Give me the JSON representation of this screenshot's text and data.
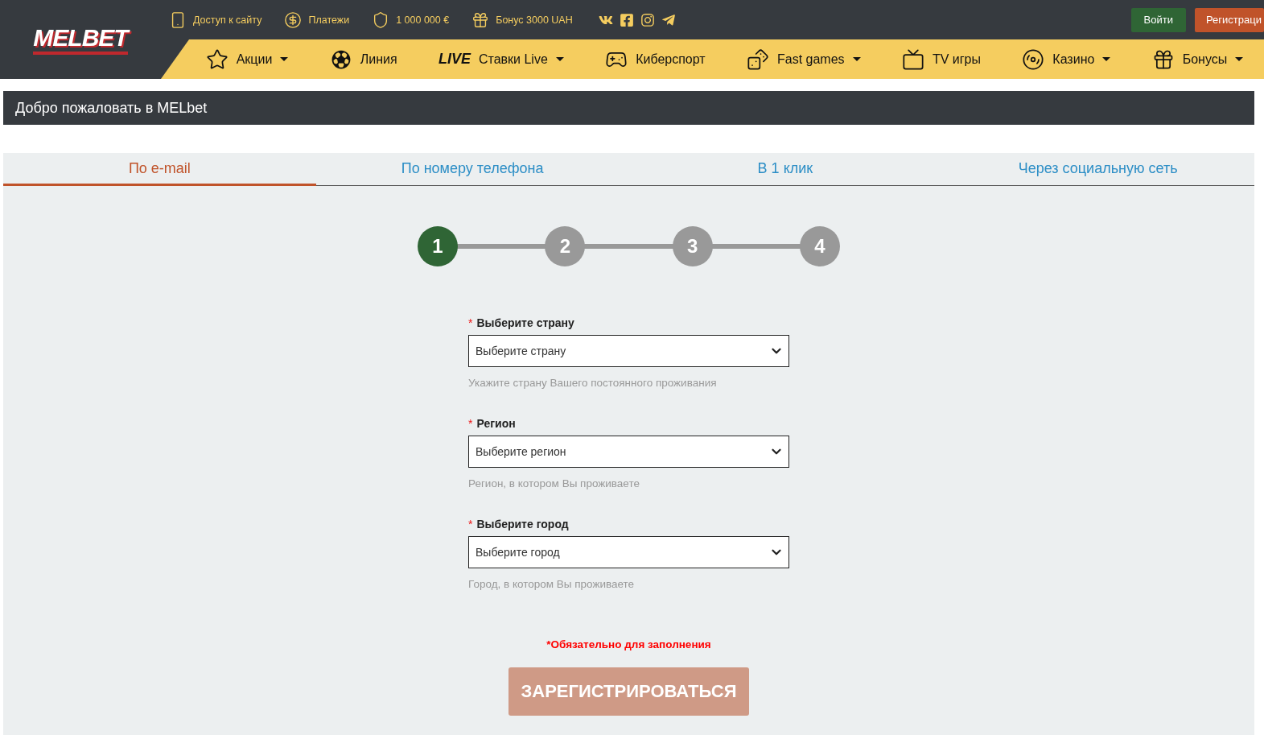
{
  "logo": {
    "text": "MELBET"
  },
  "top_links": [
    {
      "label": "Доступ к сайту"
    },
    {
      "label": "Платежи"
    },
    {
      "label": "1 000 000 €"
    },
    {
      "label": "Бонус 3000 UAH"
    }
  ],
  "auth_buttons": [
    {
      "kind": "login",
      "label": "Войти"
    },
    {
      "kind": "register",
      "label": "Регистраци"
    }
  ],
  "nav": [
    {
      "label": "Акции",
      "dropdown": true
    },
    {
      "label": "Линия",
      "dropdown": false
    },
    {
      "badge": "LIVE",
      "label": "Ставки Live",
      "dropdown": true
    },
    {
      "label": "Киберспорт",
      "dropdown": false
    },
    {
      "label": "Fast games",
      "dropdown": true
    },
    {
      "label": "TV игры",
      "dropdown": false
    },
    {
      "label": "Казино",
      "dropdown": true
    },
    {
      "label": "Бонусы",
      "dropdown": true
    }
  ],
  "welcome": "Добро пожаловать в MELbet",
  "tabs": [
    {
      "label": "По e-mail",
      "selected": true
    },
    {
      "label": "По номеру телефона",
      "selected": false
    },
    {
      "label": "В 1 клик",
      "selected": false
    },
    {
      "label": "Через социальную сеть",
      "selected": false
    }
  ],
  "steps": [
    {
      "label": "1",
      "active": true
    },
    {
      "label": "2",
      "active": false
    },
    {
      "label": "3",
      "active": false
    },
    {
      "label": "4",
      "active": false
    }
  ],
  "fields": [
    {
      "marker": "*",
      "label": "Выберите страну",
      "placeholder": "Выберите страну",
      "hint": "Укажите страну Вашего постоянного проживания"
    },
    {
      "marker": "*",
      "label": "Регион",
      "placeholder": "Выберите регион",
      "hint": "Регион, в котором Вы проживаете"
    },
    {
      "marker": "*",
      "label": "Выберите город",
      "placeholder": "Выберите город",
      "hint": "Город, в котором Вы проживаете"
    }
  ],
  "required_note": "*Обязательно для заполнения",
  "submit": {
    "label": "ЗАРЕГИСТРИРОВАТЬСЯ",
    "disabled": true
  }
}
